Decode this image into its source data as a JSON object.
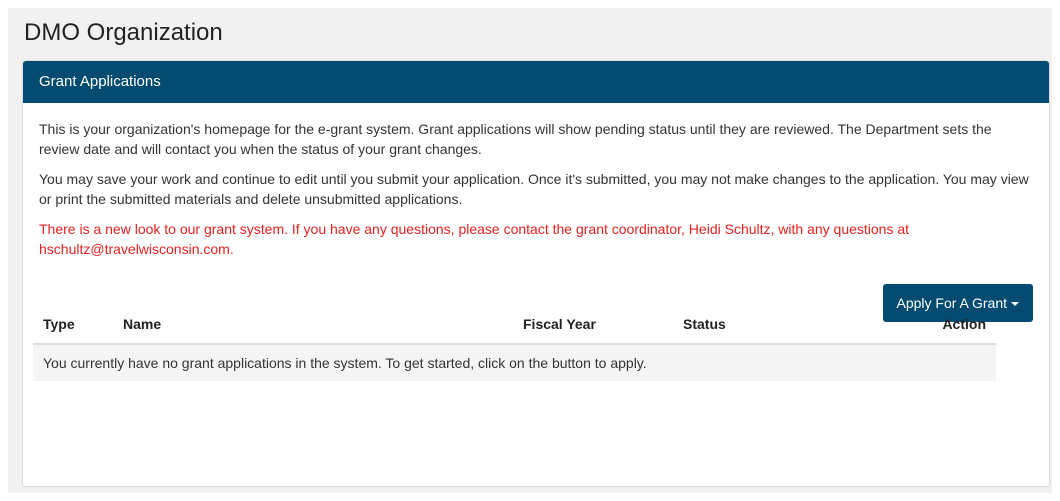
{
  "page": {
    "title": "DMO Organization"
  },
  "panel": {
    "header": "Grant Applications",
    "paragraphs": [
      "This is your organization's homepage for the e-grant system. Grant applications will show pending status until they are reviewed. The Department sets the review date and will contact you when the status of your grant changes.",
      "You may save your work and continue to edit until you submit your application. Once it's submitted, you may not make changes to the application. You may view or print the submitted materials and delete unsubmitted applications."
    ],
    "notice": "There is a new look to our grant system. If you have any questions, please contact the grant coordinator, Heidi Schultz, with any questions at hschultz@travelwisconsin.com.",
    "apply_button": "Apply For A Grant",
    "table": {
      "columns": [
        "Type",
        "Name",
        "Fiscal Year",
        "Status",
        "Action"
      ],
      "empty_message": "You currently have no grant applications in the system. To get started, click on the button to apply."
    }
  },
  "colors": {
    "header": "#034b70",
    "notice": "#e8211f",
    "page_bg": "#f1f1f1"
  },
  "icons": {
    "apply_dropdown": "caret-down-icon"
  }
}
